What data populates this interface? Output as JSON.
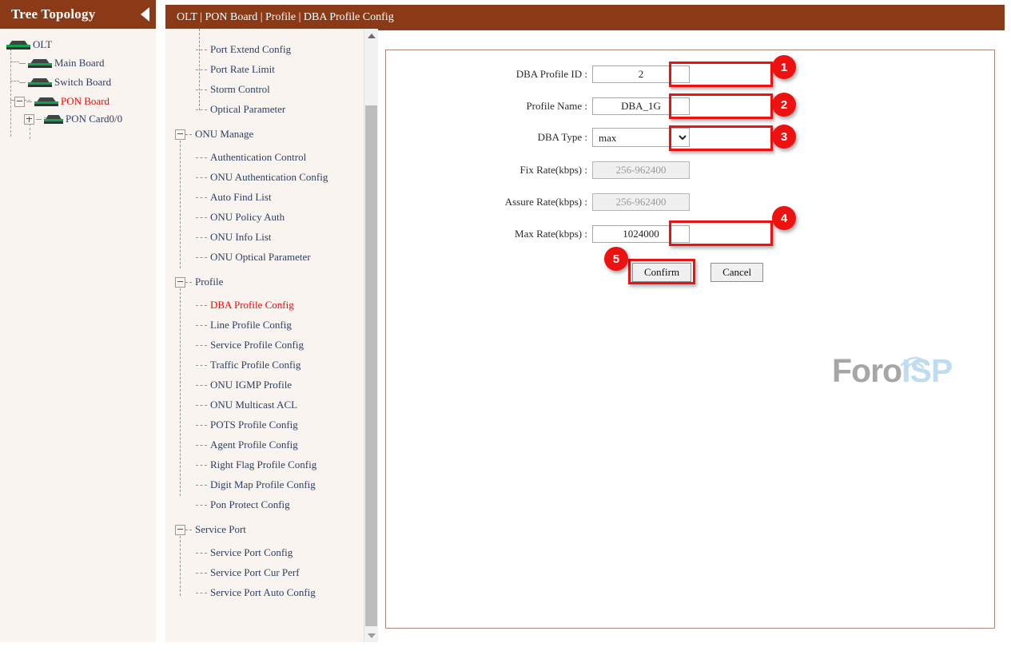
{
  "tree_panel": {
    "title": "Tree Topology",
    "collapse_icon": "caret-left-icon",
    "nodes": [
      {
        "label": "OLT",
        "icon": "device-board-icon",
        "expander": null,
        "active": false
      },
      {
        "label": "Main Board",
        "icon": "device-board-icon",
        "expander": null,
        "active": false
      },
      {
        "label": "Switch Board",
        "icon": "device-board-icon",
        "expander": null,
        "active": false
      },
      {
        "label": "PON Board",
        "icon": "device-board-icon",
        "expander": "minus",
        "active": true
      },
      {
        "label": "PON Card0/0",
        "icon": "device-board-icon",
        "expander": "plus",
        "active": false
      }
    ]
  },
  "topbar": {
    "breadcrumb": "OLT | PON Board | Profile | DBA Profile Config"
  },
  "menu": {
    "scroll": {
      "up_icon": "triangle-up-icon",
      "down_icon": "triangle-down-icon"
    },
    "items": [
      {
        "label": "Port Extend Config",
        "type": "leaf",
        "active": false
      },
      {
        "label": "Port Rate Limit",
        "type": "leaf",
        "active": false
      },
      {
        "label": "Storm Control",
        "type": "leaf",
        "active": false
      },
      {
        "label": "Optical Parameter",
        "type": "leaf",
        "active": false
      },
      {
        "label": "ONU Manage",
        "type": "group",
        "active": false
      },
      {
        "label": "Authentication Control",
        "type": "leaf",
        "active": false
      },
      {
        "label": "ONU Authentication Config",
        "type": "leaf",
        "active": false
      },
      {
        "label": "Auto Find List",
        "type": "leaf",
        "active": false
      },
      {
        "label": "ONU Policy Auth",
        "type": "leaf",
        "active": false
      },
      {
        "label": "ONU Info List",
        "type": "leaf",
        "active": false
      },
      {
        "label": "ONU Optical Parameter",
        "type": "leaf",
        "active": false
      },
      {
        "label": "Profile",
        "type": "group",
        "active": false
      },
      {
        "label": "DBA Profile Config",
        "type": "leaf",
        "active": true
      },
      {
        "label": "Line Profile Config",
        "type": "leaf",
        "active": false
      },
      {
        "label": "Service Profile Config",
        "type": "leaf",
        "active": false
      },
      {
        "label": "Traffic Profile Config",
        "type": "leaf",
        "active": false
      },
      {
        "label": "ONU IGMP Profile",
        "type": "leaf",
        "active": false
      },
      {
        "label": "ONU Multicast ACL",
        "type": "leaf",
        "active": false
      },
      {
        "label": "POTS Profile Config",
        "type": "leaf",
        "active": false
      },
      {
        "label": "Agent Profile Config",
        "type": "leaf",
        "active": false
      },
      {
        "label": "Right Flag Profile Config",
        "type": "leaf",
        "active": false
      },
      {
        "label": "Digit Map Profile Config",
        "type": "leaf",
        "active": false
      },
      {
        "label": "Pon Protect Config",
        "type": "leaf",
        "active": false
      },
      {
        "label": "Service Port",
        "type": "group",
        "active": false
      },
      {
        "label": "Service Port Config",
        "type": "leaf",
        "active": false
      },
      {
        "label": "Service Port Cur Perf",
        "type": "leaf",
        "active": false
      },
      {
        "label": "Service Port Auto Config",
        "type": "leaf",
        "active": false
      }
    ]
  },
  "form": {
    "fields": {
      "dba_profile_id": {
        "label": "DBA Profile ID :",
        "value": "2",
        "placeholder": "",
        "disabled": false,
        "highlighted": true
      },
      "profile_name": {
        "label": "Profile Name :",
        "value": "DBA_1G",
        "placeholder": "",
        "disabled": false,
        "highlighted": true
      },
      "dba_type": {
        "label": "DBA Type :",
        "value": "max",
        "options": [
          "max"
        ],
        "disabled": false,
        "highlighted": true
      },
      "fix_rate": {
        "label": "Fix Rate(kbps) :",
        "value": "",
        "placeholder": "256-962400",
        "disabled": true,
        "highlighted": false
      },
      "assure_rate": {
        "label": "Assure Rate(kbps) :",
        "value": "",
        "placeholder": "256-962400",
        "disabled": true,
        "highlighted": false
      },
      "max_rate": {
        "label": "Max Rate(kbps) :",
        "value": "1024000",
        "placeholder": "",
        "disabled": false,
        "highlighted": true
      }
    },
    "buttons": {
      "confirm": "Confirm",
      "cancel": "Cancel"
    }
  },
  "badges": [
    {
      "number": "1"
    },
    {
      "number": "2"
    },
    {
      "number": "3"
    },
    {
      "number": "4"
    },
    {
      "number": "5"
    }
  ],
  "watermark": {
    "part1": "Foro",
    "part2": "ISP"
  },
  "colors": {
    "header_brown": "#8b3a18",
    "panel_bg": "#faf4f1",
    "active_red": "#ff0000",
    "badge_red": "#ee1111",
    "link_navy": "#2b3f63",
    "watermark_gray": "#a6a6a6",
    "watermark_blue": "#bfdcf0"
  }
}
